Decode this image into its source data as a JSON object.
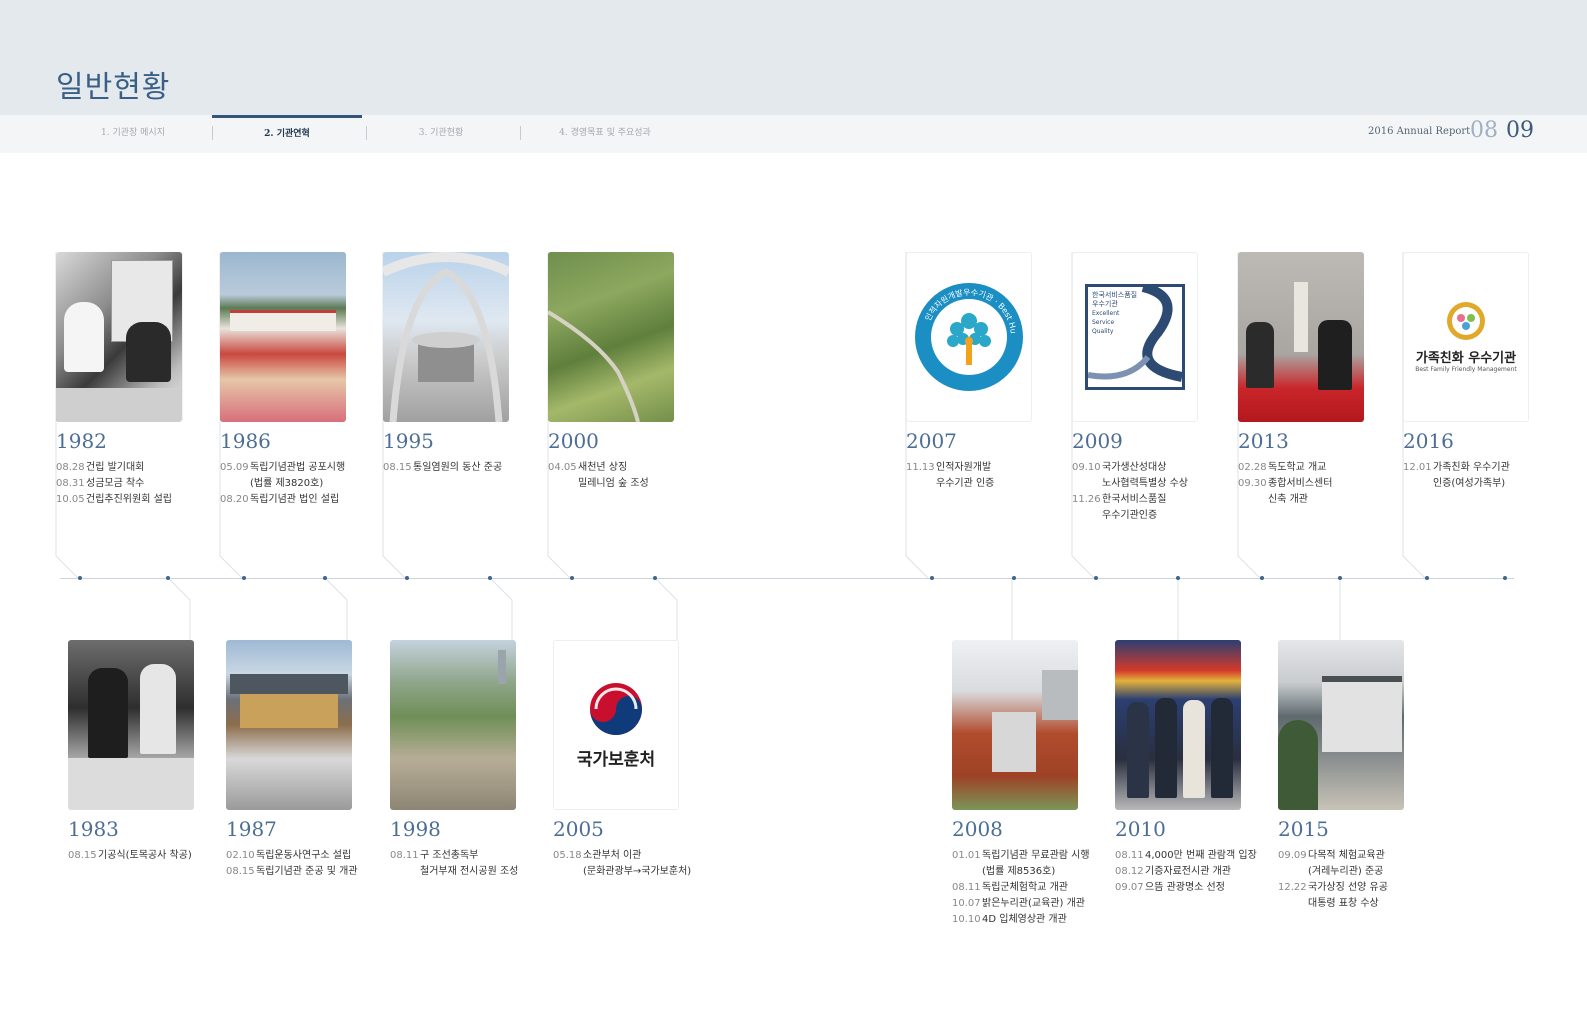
{
  "header": {
    "title": "일반현황"
  },
  "nav": [
    {
      "label": "1. 기관장 메시지"
    },
    {
      "label": "2. 기관연혁"
    },
    {
      "label": "3. 기관현황"
    },
    {
      "label": "4. 경영목표 및 주요성과"
    }
  ],
  "report": {
    "label": "2016 Annual Report",
    "page_left": "08",
    "page_right": "09"
  },
  "logos": {
    "hrd_badge": "인적자원개발우수기관 · Best Human Resources Developer",
    "service_quality": [
      "한국서비스품질",
      "우수기관",
      "Excellent",
      "Service",
      "Quality"
    ],
    "mpva": "국가보훈처",
    "family": "가족친화 우수기관",
    "family_en": "Best Family Friendly Management"
  },
  "top": [
    {
      "year": "1982",
      "events": [
        {
          "date": "08.28",
          "text": "건립 발기대회"
        },
        {
          "date": "08.31",
          "text": "성금모금 착수"
        },
        {
          "date": "10.05",
          "text": "건립추진위원회 설립"
        }
      ]
    },
    {
      "year": "1986",
      "events": [
        {
          "date": "05.09",
          "text": "독립기념관법 공포시행"
        },
        {
          "date": "",
          "text": "(법률 제3820호)"
        },
        {
          "date": "08.20",
          "text": "독립기념관 법인 설립"
        }
      ]
    },
    {
      "year": "1995",
      "events": [
        {
          "date": "08.15",
          "text": "통일염원의 동산 준공"
        }
      ]
    },
    {
      "year": "2000",
      "events": [
        {
          "date": "04.05",
          "text": "새천년 상징"
        },
        {
          "date": "",
          "text": "밀레니엄 숲 조성"
        }
      ]
    },
    {
      "year": "2007",
      "events": [
        {
          "date": "11.13",
          "text": "인적자원개발"
        },
        {
          "date": "",
          "text": "우수기관 인증"
        }
      ]
    },
    {
      "year": "2009",
      "events": [
        {
          "date": "09.10",
          "text": "국가생산성대상"
        },
        {
          "date": "",
          "text": "노사협력특별상 수상"
        },
        {
          "date": "11.26",
          "text": "한국서비스품질"
        },
        {
          "date": "",
          "text": "우수기관인증"
        }
      ]
    },
    {
      "year": "2013",
      "events": [
        {
          "date": "02.28",
          "text": "독도학교 개교"
        },
        {
          "date": "09.30",
          "text": "종합서비스센터"
        },
        {
          "date": "",
          "text": "신축 개관"
        }
      ]
    },
    {
      "year": "2016",
      "events": [
        {
          "date": "12.01",
          "text": "가족친화 우수기관"
        },
        {
          "date": "",
          "text": "인증(여성가족부)"
        }
      ]
    }
  ],
  "bottom": [
    {
      "year": "1983",
      "events": [
        {
          "date": "08.15",
          "text": "기공식(토목공사 착공)"
        }
      ]
    },
    {
      "year": "1987",
      "events": [
        {
          "date": "02.10",
          "text": "독립운동사연구소 설립"
        },
        {
          "date": "08.15",
          "text": "독립기념관 준공 및 개관"
        }
      ]
    },
    {
      "year": "1998",
      "events": [
        {
          "date": "08.11",
          "text": "구 조선총독부"
        },
        {
          "date": "",
          "text": "철거부재 전시공원 조성"
        }
      ]
    },
    {
      "year": "2005",
      "events": [
        {
          "date": "05.18",
          "text": "소관부처 이관"
        },
        {
          "date": "",
          "text": "(문화관광부→국가보훈처)"
        }
      ]
    },
    {
      "year": "2008",
      "events": [
        {
          "date": "01.01",
          "text": "독립기념관 무료관람 시행"
        },
        {
          "date": "",
          "text": "(법률 제8536호)"
        },
        {
          "date": "08.11",
          "text": "독립군체험학교 개관"
        },
        {
          "date": "10.07",
          "text": "밝은누리관(교육관) 개관"
        },
        {
          "date": "10.10",
          "text": "4D 입체영상관 개관"
        }
      ]
    },
    {
      "year": "2010",
      "events": [
        {
          "date": "08.11",
          "text": "4,000만 번째 관람객 입장"
        },
        {
          "date": "08.12",
          "text": "기증자료전시관 개관"
        },
        {
          "date": "09.07",
          "text": "으뜸 관광명소 선정"
        }
      ]
    },
    {
      "year": "2015",
      "events": [
        {
          "date": "09.09",
          "text": "다목적 체험교육관"
        },
        {
          "date": "",
          "text": "(겨레누리관) 준공"
        },
        {
          "date": "12.22",
          "text": "국가상징 선양 유공"
        },
        {
          "date": "",
          "text": "대통령 표창 수상"
        }
      ]
    }
  ]
}
